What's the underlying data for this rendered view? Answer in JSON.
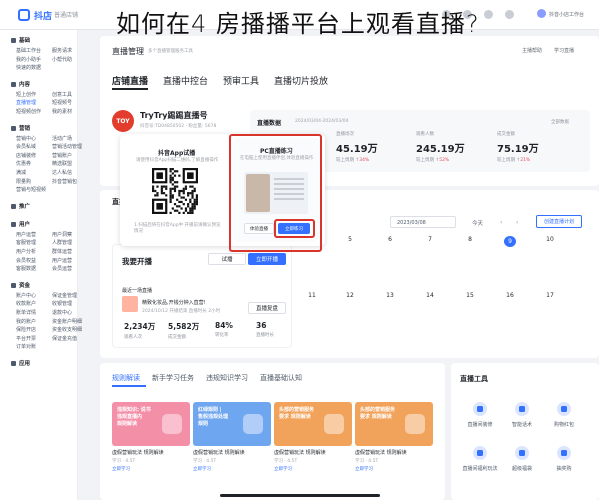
{
  "headline": "如何在4 房播播平台上观看直播?",
  "topbar": {
    "app_name": "抖店",
    "workspace": "普通店铺",
    "user": "抖音小店工作台"
  },
  "sidebar": {
    "sections": [
      {
        "title": "基础",
        "rows": [
          [
            "基础工作台",
            "服务请求"
          ],
          [
            "我的小助手",
            "小帮代助"
          ],
          [
            "快速的数据",
            ""
          ]
        ]
      },
      {
        "title": "内容",
        "rows": [
          [
            "短上创作",
            "创意工具"
          ],
          [
            "直播管理",
            "短视频号"
          ],
          [
            "短视频创作",
            "我的素材"
          ]
        ]
      },
      {
        "title": "营销",
        "rows": [
          [
            "营销中心",
            "活动广场"
          ],
          [
            "会员私域",
            "营销活动管理"
          ],
          [
            "店铺装修",
            "营销账户"
          ],
          [
            "优惠券",
            "精选联盟"
          ],
          [
            "满减",
            "达人私信"
          ],
          [
            "限量购",
            "抖音营销包"
          ],
          [
            "营销与短视频",
            ""
          ]
        ]
      },
      {
        "title": "推广",
        "rows": []
      },
      {
        "title": "用户",
        "rows": [
          [
            "用户运营",
            "用户洞察"
          ],
          [
            "客服管理",
            "人群管理"
          ],
          [
            "用户分析",
            "群体运营"
          ],
          [
            "会员权益",
            "用户运营"
          ],
          [
            "客服数据",
            "会员运营"
          ]
        ]
      },
      {
        "title": "资金",
        "rows": [
          [
            "账户中心",
            "保证金管理"
          ],
          [
            "收款账户",
            "收银管理"
          ],
          [
            "账单详情",
            "退款中心"
          ],
          [
            "我的账户",
            "资金账户明细"
          ],
          [
            "保险开店",
            "资金收支明细"
          ],
          [
            "平台开票",
            "保证金充值"
          ],
          [
            "订单对账",
            ""
          ]
        ]
      },
      {
        "title": "应用",
        "rows": []
      }
    ]
  },
  "page": {
    "title": "直播管理",
    "subtitle": "多个直播管理服务工具",
    "actions": [
      "主播帮助",
      "学习直播"
    ]
  },
  "tabs": [
    "店铺直播",
    "直播中控台",
    "预审工具",
    "直播切片投放"
  ],
  "account": {
    "avatar_text": "TOY",
    "name": "TryTry踢踢直播号",
    "meta": "抖音号:TD04850502   ·  粉丝量: 5678"
  },
  "data_panel": {
    "title": "直播数据",
    "range": "2024/03/04-2024/03/04",
    "more": "全部数据",
    "metrics": [
      {
        "label": "直播场次",
        "value": "45.19万",
        "cmp": "较上周期",
        "delta": "34%"
      },
      {
        "label": "观看人数",
        "value": "245.19万",
        "cmp": "较上周期",
        "delta": "52%"
      },
      {
        "label": "成交金额",
        "value": "75.19万",
        "cmp": "较上周期",
        "delta": "21%"
      }
    ]
  },
  "schedule": {
    "section_title": "直播",
    "date": "2023/03/08",
    "today": "今天",
    "prev": "‹",
    "next": "›",
    "create": "创建直播计划",
    "days_row1": [
      "5",
      "6",
      "7",
      "8",
      "9",
      "10"
    ],
    "days_row2": [
      "11",
      "12",
      "13",
      "14",
      "15",
      "16",
      "17"
    ],
    "selected_day": "9"
  },
  "start_live": {
    "title": "我要开播",
    "btn_plain": "试播",
    "btn_primary": "立即开播",
    "recent_label": "最近一场直播",
    "recent_title": "精致化妆品,开钱分钟入直营!",
    "recent_date": "2024/10/12  开播结束 直播时长 2小时",
    "review_btn": "直播复盘",
    "stats": [
      {
        "value": "2,234万",
        "label": "观看人次"
      },
      {
        "value": "5,582万",
        "label": "成交金额"
      },
      {
        "value": "84%",
        "label": "转化率"
      },
      {
        "value": "36",
        "label": "直播时长"
      }
    ]
  },
  "overlay": {
    "app_title": "抖音App试播",
    "app_sub": "请使用抖音App扫描二维码,了解直播操作",
    "app_foot": "1.扫描后将在抖音App中  开播前请确认预览情况",
    "pc_title": "PC直播练习",
    "pc_sub": "在电脑上使用直播伴侣,体验直播操作",
    "pc_btn_plain": "体验直播",
    "pc_btn_primary": "立即练习"
  },
  "learn": {
    "tabs": [
      "规则解读",
      "新手学习任务",
      "违规知识学习",
      "直播基础认知"
    ],
    "tiles": [
      {
        "text": "违规知识: 说书\n违规直播内\n规则解读",
        "color": "#f48fa8",
        "caption": "虚假营销玩法 规则解读",
        "meta": "学习 · 4.5T",
        "link": "立即学习"
      },
      {
        "text": "红绿规则 |\n售假违规处理\n规则",
        "color": "#6fa6f0",
        "caption": "虚假营销玩法 规则解读",
        "meta": "学习 · 4.5T",
        "link": "立即学习"
      },
      {
        "text": "头部的营销服务\n要求 规则解读",
        "color": "#f2a35b",
        "caption": "虚假营销玩法 规则解读",
        "meta": "学习 · 4.5T",
        "link": "立即学习"
      },
      {
        "text": "头部的营销服务\n要求 规则解读",
        "color": "#f2a35b",
        "caption": "虚假营销玩法 规则解读",
        "meta": "学习 · 4.5T",
        "link": "立即学习"
      }
    ]
  },
  "tools": {
    "title": "直播工具",
    "items": [
      "直播间装修",
      "智能话术",
      "购物红包",
      "直播间福利玩法",
      "超级福袋",
      "抽奖购"
    ]
  },
  "colors": {
    "brand": "#3370ff",
    "highlight": "#d9352d"
  }
}
